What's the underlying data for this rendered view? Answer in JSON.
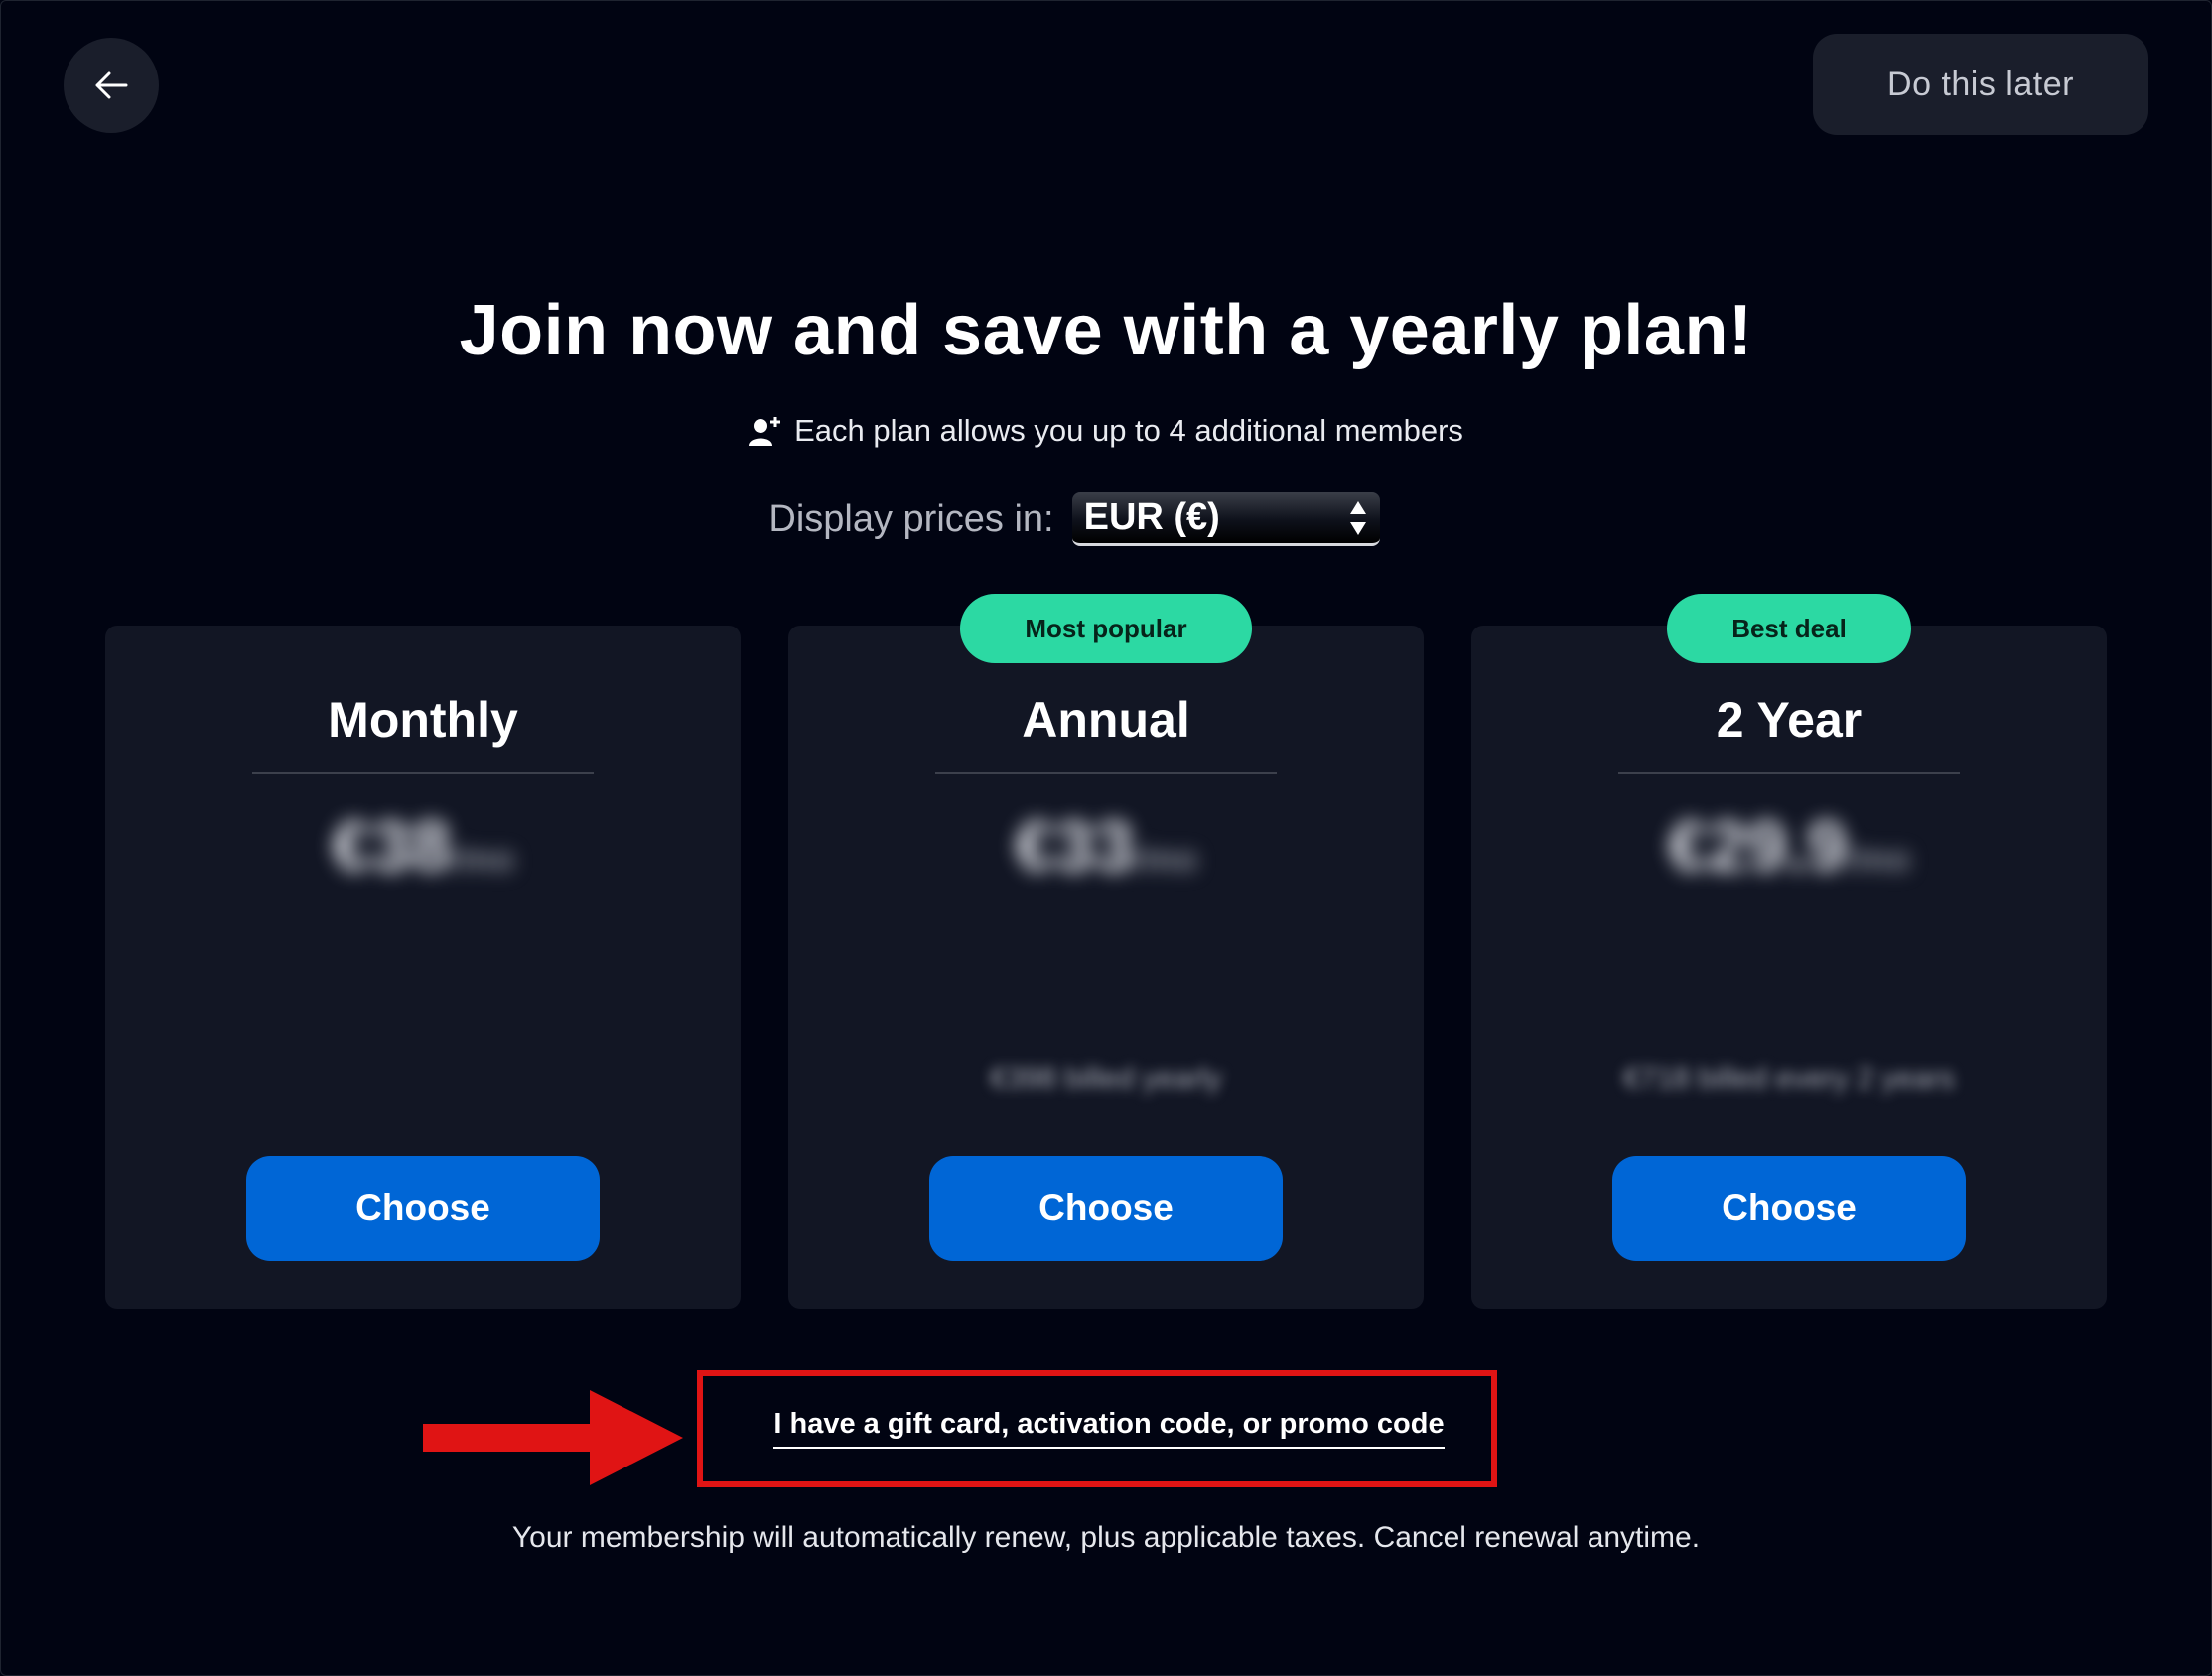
{
  "header": {
    "later_label": "Do this later"
  },
  "main": {
    "heading": "Join now and save with a yearly plan!",
    "members_note": "Each plan allows you up to 4 additional members",
    "currency_label": "Display prices in:",
    "currency_value": "EUR (€)"
  },
  "plans": [
    {
      "name": "Monthly",
      "badge": "",
      "price": "€38",
      "per": "/mo",
      "note": "",
      "button": "Choose"
    },
    {
      "name": "Annual",
      "badge": "Most popular",
      "price": "€33",
      "per": "/mo",
      "note": "€398 billed yearly",
      "button": "Choose"
    },
    {
      "name": "2 Year",
      "badge": "Best deal",
      "price": "€29.9",
      "per": "/mo",
      "note": "€718 billed every 2 years",
      "button": "Choose"
    }
  ],
  "promo": {
    "link_label": "I have a gift card, activation code, or promo code"
  },
  "footer": {
    "text": "Your membership will automatically renew, plus applicable taxes. Cancel renewal anytime."
  },
  "colors": {
    "background": "#010412",
    "card": "#121624",
    "button": "#0066d6",
    "badge": "#2cd9a3",
    "annotation": "#e01414"
  },
  "icons": {
    "back": "arrow-left-icon",
    "members": "person-add-icon",
    "select": "select-arrows-icon"
  }
}
